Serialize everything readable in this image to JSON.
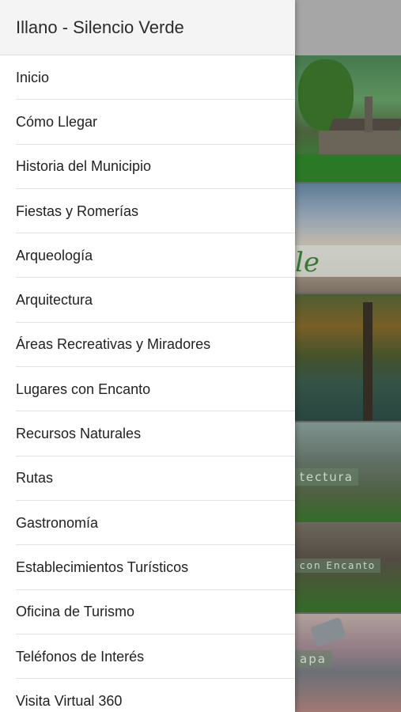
{
  "drawer": {
    "title": "Illano - Silencio Verde",
    "items": [
      {
        "label": "Inicio"
      },
      {
        "label": "Cómo Llegar"
      },
      {
        "label": "Historia del Municipio"
      },
      {
        "label": "Fiestas y Romerías"
      },
      {
        "label": "Arqueología"
      },
      {
        "label": "Arquitectura"
      },
      {
        "label": "Áreas Recreativas y Miradores"
      },
      {
        "label": "Lugares con Encanto"
      },
      {
        "label": "Recursos Naturales"
      },
      {
        "label": "Rutas"
      },
      {
        "label": "Gastronomía"
      },
      {
        "label": "Establecimientos Turísticos"
      },
      {
        "label": "Oficina de Turismo"
      },
      {
        "label": "Teléfonos de Interés"
      },
      {
        "label": "Visita Virtual 360"
      }
    ]
  },
  "background": {
    "tile_script": "le",
    "tile_architecture_label": "tectura",
    "tile_places_label": "con Encanto",
    "tile_map_label": "apa"
  },
  "colors": {
    "drawer_bg": "#ffffff",
    "header_bg": "#f4f4f4",
    "divider": "#e3e3e3",
    "text": "#222222",
    "accent_green": "#3f8a3a"
  }
}
